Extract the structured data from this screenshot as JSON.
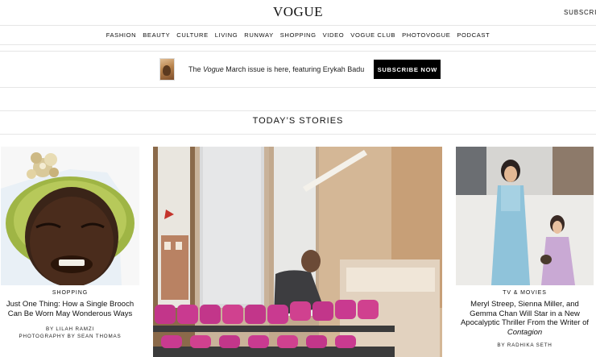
{
  "header": {
    "logo": "VOGUE",
    "subscribe_link": "SUBSCRIBE"
  },
  "nav": [
    "FASHION",
    "BEAUTY",
    "CULTURE",
    "LIVING",
    "RUNWAY",
    "SHOPPING",
    "VIDEO",
    "VOGUE CLUB",
    "PHOTOVOGUE",
    "PODCAST"
  ],
  "promo": {
    "prefix": "The ",
    "magazine": "Vogue",
    "suffix": " March issue is here, featuring Erykah Badu",
    "button": "SUBSCRIBE NOW"
  },
  "section_title": "TODAY’S STORIES",
  "stories": {
    "left": {
      "kicker": "SHOPPING",
      "headline": "Just One Thing: How a Single Brooch Can Be Worn May Wonderous Ways",
      "byline": "BY LILAH RAMZI",
      "photo_credit": "PHOTOGRAPHY BY SEAN THOMAS"
    },
    "right": {
      "kicker": "TV & MOVIES",
      "headline_main": "Meryl Streep, Sienna Miller, and Gemma Chan Will Star in a New Apocalyptic Thriller From the Writer of ",
      "headline_italic": "Contagion",
      "byline": "BY RADHIKA SETH"
    }
  }
}
